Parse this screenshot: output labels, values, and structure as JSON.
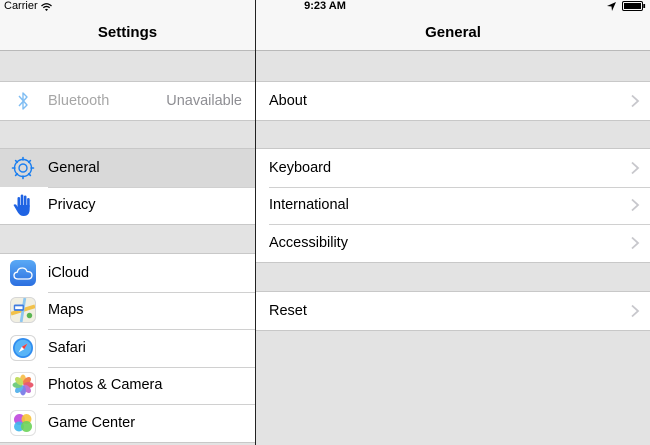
{
  "status_bar": {
    "carrier": "Carrier",
    "time": "9:23 AM",
    "wifi_icon": "wifi-icon",
    "location_icon": "location-arrow-icon",
    "battery_icon": "battery-icon"
  },
  "master": {
    "title": "Settings",
    "groups": [
      {
        "items": [
          {
            "label": "Bluetooth",
            "value": "Unavailable",
            "icon": "bluetooth-icon",
            "disabled": true
          }
        ]
      },
      {
        "items": [
          {
            "label": "General",
            "icon": "gear-icon",
            "selected": true
          },
          {
            "label": "Privacy",
            "icon": "hand-icon"
          }
        ]
      },
      {
        "items": [
          {
            "label": "iCloud",
            "icon": "cloud-icon"
          },
          {
            "label": "Maps",
            "icon": "map-icon"
          },
          {
            "label": "Safari",
            "icon": "compass-icon"
          },
          {
            "label": "Photos & Camera",
            "icon": "flower-icon"
          },
          {
            "label": "Game Center",
            "icon": "bubbles-icon"
          }
        ]
      }
    ]
  },
  "detail": {
    "title": "General",
    "groups": [
      {
        "items": [
          {
            "label": "About"
          }
        ]
      },
      {
        "items": [
          {
            "label": "Keyboard"
          },
          {
            "label": "International"
          },
          {
            "label": "Accessibility"
          }
        ]
      },
      {
        "items": [
          {
            "label": "Reset"
          }
        ]
      }
    ]
  },
  "colors": {
    "background": "#e3e3e3",
    "selected_row": "#d9d9d9",
    "bluetooth": "#7fbdf3",
    "gear": "#1b7ff0",
    "privacy": "#1f63e3",
    "chevron": "#c7c7cc"
  }
}
